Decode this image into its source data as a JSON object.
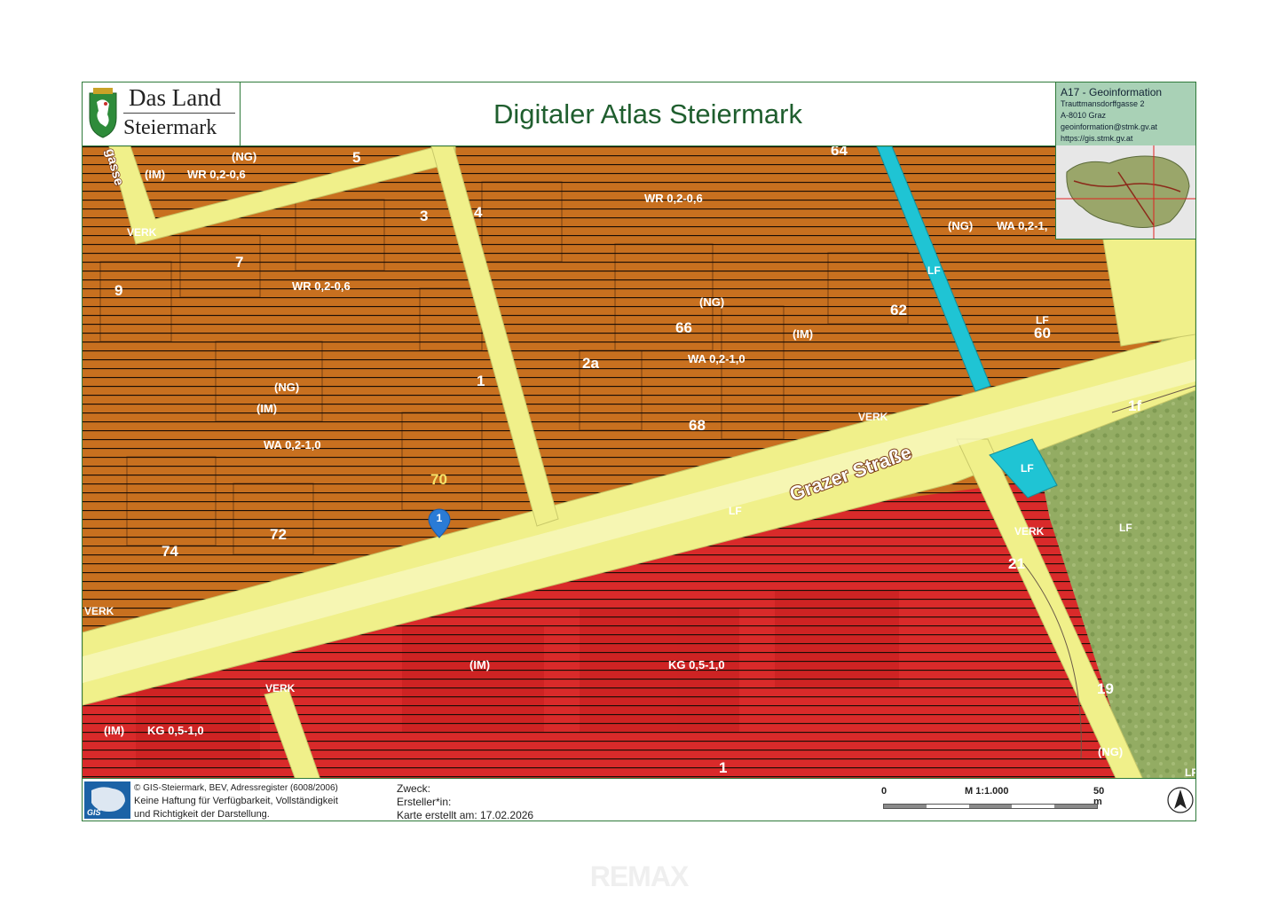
{
  "header": {
    "logo_line1": "Das Land",
    "logo_line2": "Steiermark",
    "title": "Digitaler Atlas Steiermark",
    "info": {
      "title": "A17 - Geoinformation",
      "street": "Trauttmansdorffgasse 2",
      "city": "A-8010 Graz",
      "email": "geoinformation@stmk.gv.at",
      "url": "https://gis.stmk.gv.at"
    }
  },
  "map": {
    "street_name": "Grazer Straße",
    "street_fragment": "gasse",
    "marker_number": "1",
    "colors": {
      "residential": "#c8701f",
      "commercial": "#d92a2a",
      "traffic": "#f0f08a",
      "forest": "#8faa5c",
      "stream": "#1fc4d4"
    },
    "labels": {
      "ng1": "(NG)",
      "im1": "(IM)",
      "wr1": "WR 0,2-0,6",
      "wr2": "WR 0,2-0,6",
      "wr3": "WR 0,2-0,6",
      "ng2": "(NG)",
      "wa1": "WA 0,2-1,",
      "ng3": "(NG)",
      "im2": "(IM)",
      "wa2": "WA 0,2-1,0",
      "ng4": "(NG)",
      "im3": "(IM)",
      "wa3": "WA 0,2-1,0",
      "im4": "(IM)",
      "kg1": "KG 0,5-1,0",
      "im5": "(IM)",
      "kg2": "KG 0,5-1,0",
      "ng5": "(NG)",
      "verk1": "VERK",
      "verk2": "VERK",
      "verk3": "VERK",
      "verk4": "VERK",
      "verk5": "VERK",
      "lf1": "LF",
      "lf2": "LF",
      "lf3": "LF",
      "lf4": "LF",
      "lf5": "LF",
      "lf6": "LF",
      "n5": "5",
      "n3": "3",
      "n4": "4",
      "n7": "7",
      "n9": "9",
      "n1a": "1",
      "n2a": "2a",
      "n64": "64",
      "n66": "66",
      "n62": "62",
      "n60": "60",
      "n68": "68",
      "n1f": "1f",
      "n70": "70",
      "n72": "72",
      "n74": "74",
      "n21": "21",
      "n19": "19",
      "n1b": "1"
    }
  },
  "footer": {
    "gis_label": "GIS",
    "copyright": "© GIS-Steiermark, BEV, Adressregister (6008/2006)",
    "disclaimer1": "Keine Haftung für Verfügbarkeit, Vollständigkeit",
    "disclaimer2": "und Richtigkeit der Darstellung.",
    "zweck": "Zweck:",
    "ersteller": "Ersteller*in:",
    "karte_erstellt": "Karte erstellt am: 17.02.2026",
    "scale_zero": "0",
    "scale_ratio": "M 1:1.000",
    "scale_max": "50 m"
  },
  "watermark": "REMAX"
}
